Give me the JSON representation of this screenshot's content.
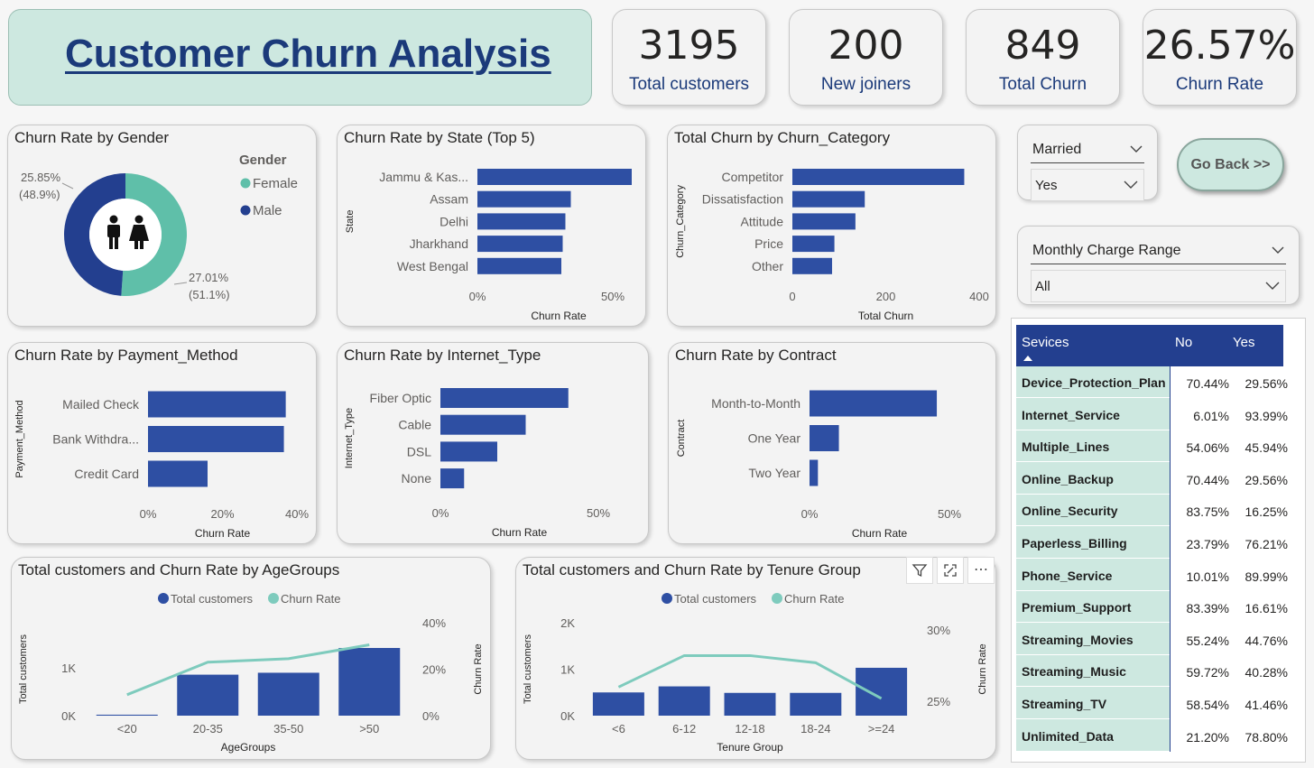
{
  "title": "Customer Churn Analysis",
  "kpis": [
    {
      "value": "3195",
      "label": "Total customers"
    },
    {
      "value": "200",
      "label": "New joiners"
    },
    {
      "value": "849",
      "label": "Total Churn"
    },
    {
      "value": "26.57%",
      "label": "Churn Rate"
    }
  ],
  "slicers": {
    "married": {
      "label": "Married",
      "value": "Yes"
    },
    "monthly": {
      "label": "Monthly Charge Range",
      "value": "All"
    }
  },
  "go_back_label": "Go Back >>",
  "matrix": {
    "headers": {
      "service": "Sevices",
      "no": "No",
      "yes": "Yes"
    },
    "rows": [
      {
        "name": "Device_Protection_Plan",
        "no": "70.44%",
        "yes": "29.56%"
      },
      {
        "name": "Internet_Service",
        "no": "6.01%",
        "yes": "93.99%"
      },
      {
        "name": "Multiple_Lines",
        "no": "54.06%",
        "yes": "45.94%"
      },
      {
        "name": "Online_Backup",
        "no": "70.44%",
        "yes": "29.56%"
      },
      {
        "name": "Online_Security",
        "no": "83.75%",
        "yes": "16.25%"
      },
      {
        "name": "Paperless_Billing",
        "no": "23.79%",
        "yes": "76.21%"
      },
      {
        "name": "Phone_Service",
        "no": "10.01%",
        "yes": "89.99%"
      },
      {
        "name": "Premium_Support",
        "no": "83.39%",
        "yes": "16.61%"
      },
      {
        "name": "Streaming_Movies",
        "no": "55.24%",
        "yes": "44.76%"
      },
      {
        "name": "Streaming_Music",
        "no": "59.72%",
        "yes": "40.28%"
      },
      {
        "name": "Streaming_TV",
        "no": "58.54%",
        "yes": "41.46%"
      },
      {
        "name": "Unlimited_Data",
        "no": "21.20%",
        "yes": "78.80%"
      }
    ]
  },
  "colors": {
    "bar": "#2e4fa3",
    "teal": "#5fbfa9",
    "line": "#7ecbbd",
    "navy": "#233f8f"
  },
  "chart_data": [
    {
      "id": "gender",
      "type": "pie",
      "title": "Churn Rate by Gender",
      "legend_title": "Gender",
      "categories": [
        "Female",
        "Male"
      ],
      "values": [
        27.01,
        25.85
      ],
      "shares": [
        "51.1%",
        "48.9%"
      ],
      "value_labels": [
        "27.01%",
        "25.85%"
      ]
    },
    {
      "id": "state",
      "type": "bar",
      "orientation": "horizontal",
      "title": "Churn Rate by State (Top 5)",
      "categories": [
        "Jammu & Kas...",
        "Assam",
        "Delhi",
        "Jharkhand",
        "West Bengal"
      ],
      "values": [
        0.57,
        0.345,
        0.325,
        0.315,
        0.31
      ],
      "xlim": [
        0,
        0.6
      ],
      "ticks": [
        0,
        0.5
      ],
      "tick_labels": [
        "0%",
        "50%"
      ],
      "xlabel": "Churn Rate",
      "ylabel": "State"
    },
    {
      "id": "category",
      "type": "bar",
      "orientation": "horizontal",
      "title": "Total Churn by Churn_Category",
      "categories": [
        "Competitor",
        "Dissatisfaction",
        "Attitude",
        "Price",
        "Other"
      ],
      "values": [
        368,
        155,
        135,
        90,
        85
      ],
      "xlim": [
        0,
        400
      ],
      "ticks": [
        0,
        200,
        400
      ],
      "tick_labels": [
        "0",
        "200",
        "400"
      ],
      "xlabel": "Total Churn",
      "ylabel": "Churn_Category"
    },
    {
      "id": "payment",
      "type": "bar",
      "orientation": "horizontal",
      "title": "Churn Rate by Payment_Method",
      "categories": [
        "Mailed Check",
        "Bank Withdra...",
        "Credit Card"
      ],
      "values": [
        0.37,
        0.365,
        0.16
      ],
      "xlim": [
        0,
        0.4
      ],
      "ticks": [
        0,
        0.2,
        0.4
      ],
      "tick_labels": [
        "0%",
        "20%",
        "40%"
      ],
      "xlabel": "Churn Rate",
      "ylabel": "Payment_Method"
    },
    {
      "id": "internet",
      "type": "bar",
      "orientation": "horizontal",
      "title": "Churn Rate by Internet_Type",
      "categories": [
        "Fiber Optic",
        "Cable",
        "DSL",
        "None"
      ],
      "values": [
        0.405,
        0.27,
        0.18,
        0.075
      ],
      "xlim": [
        0,
        0.5
      ],
      "ticks": [
        0,
        0.5
      ],
      "tick_labels": [
        "0%",
        "50%"
      ],
      "xlabel": "Churn Rate",
      "ylabel": "Internet_Type"
    },
    {
      "id": "contract",
      "type": "bar",
      "orientation": "horizontal",
      "title": "Churn Rate by Contract",
      "categories": [
        "Month-to-Month",
        "One Year",
        "Two Year"
      ],
      "values": [
        0.455,
        0.105,
        0.03
      ],
      "xlim": [
        0,
        0.5
      ],
      "ticks": [
        0,
        0.5
      ],
      "tick_labels": [
        "0%",
        "50%"
      ],
      "xlabel": "Churn Rate",
      "ylabel": "Contract"
    },
    {
      "id": "age",
      "type": "bar+line",
      "title": "Total customers and Churn Rate by AgeGroups",
      "categories": [
        "<20",
        "20-35",
        "35-50",
        ">50"
      ],
      "series": [
        {
          "name": "Total customers",
          "type": "bar",
          "values": [
            20,
            860,
            900,
            1420
          ]
        },
        {
          "name": "Churn Rate",
          "type": "line",
          "values": [
            0.09,
            0.23,
            0.245,
            0.305
          ]
        }
      ],
      "ylim": [
        0,
        1950
      ],
      "y2lim": [
        0,
        0.4
      ],
      "yticks": [
        0,
        1000
      ],
      "ytick_labels": [
        "0K",
        "1K"
      ],
      "y2ticks": [
        0,
        0.2,
        0.4
      ],
      "y2tick_labels": [
        "0%",
        "20%",
        "40%"
      ],
      "xlabel": "AgeGroups",
      "ylabel": "Total customers",
      "y2label": "Churn Rate"
    },
    {
      "id": "tenure",
      "type": "bar+line",
      "title": "Total customers and Churn Rate by Tenure Group",
      "categories": [
        "<6",
        "6-12",
        "12-18",
        "18-24",
        ">=24"
      ],
      "series": [
        {
          "name": "Total customers",
          "type": "bar",
          "values": [
            500,
            630,
            490,
            490,
            1030
          ]
        },
        {
          "name": "Churn Rate",
          "type": "line",
          "values": [
            0.26,
            0.282,
            0.282,
            0.277,
            0.252
          ]
        }
      ],
      "ylim": [
        0,
        2000
      ],
      "y2lim": [
        0.24,
        0.305
      ],
      "yticks": [
        0,
        1000,
        2000
      ],
      "ytick_labels": [
        "0K",
        "1K",
        "2K"
      ],
      "y2ticks": [
        0.25,
        0.3
      ],
      "y2tick_labels": [
        "25%",
        "30%"
      ],
      "xlabel": "Tenure Group",
      "ylabel": "Total customers",
      "y2label": "Churn Rate"
    }
  ]
}
